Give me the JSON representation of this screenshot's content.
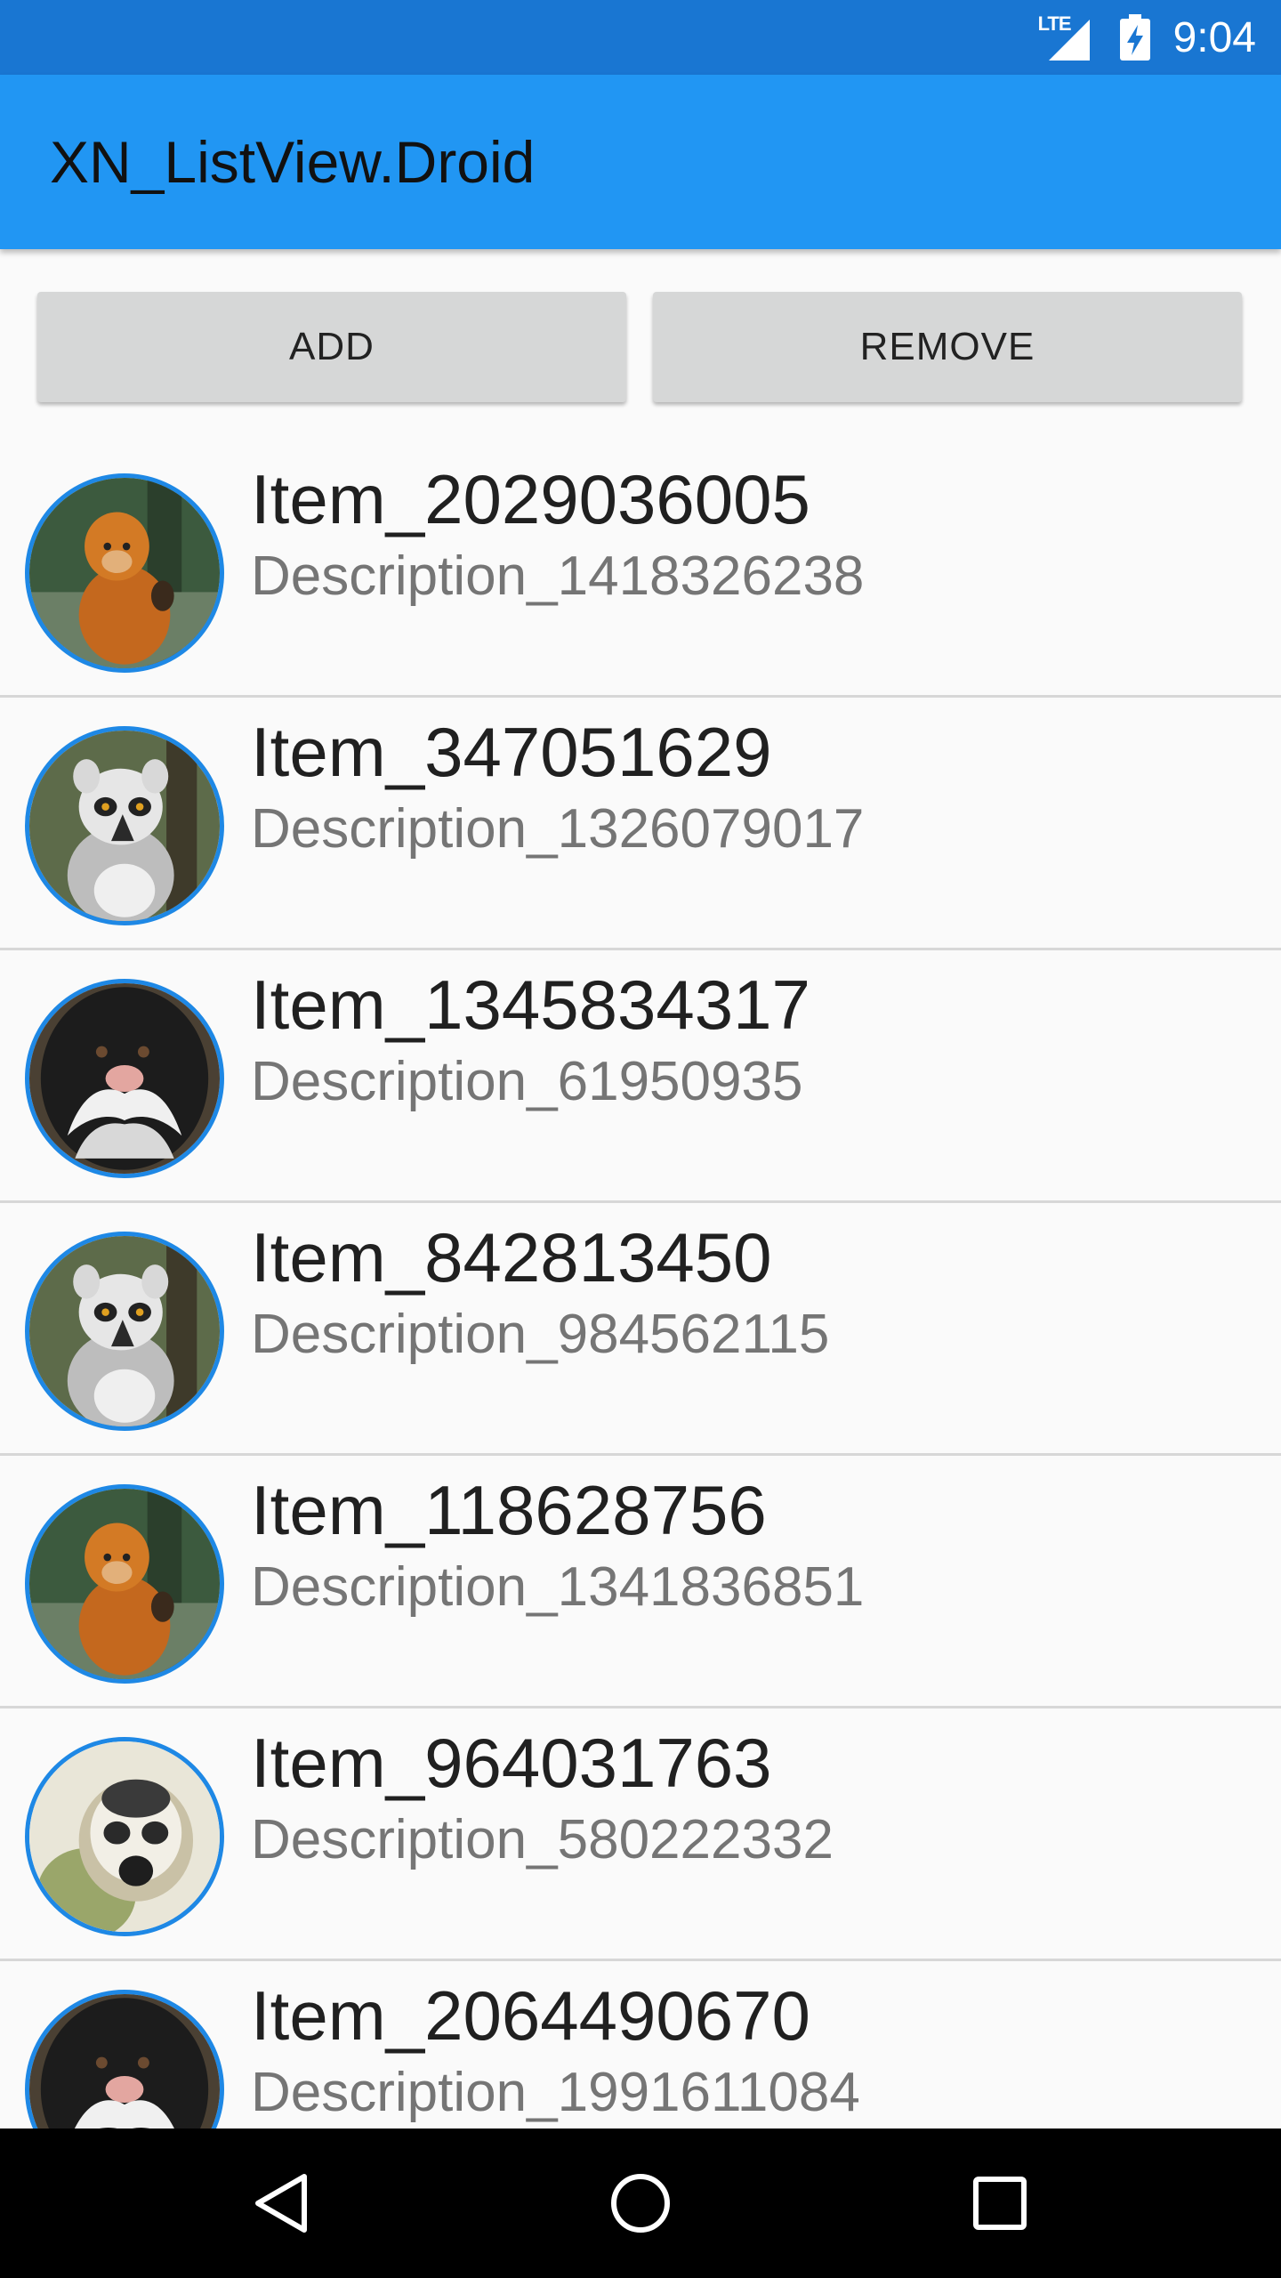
{
  "status_bar": {
    "network_label": "LTE",
    "time": "9:04",
    "background_color": "#1976d2",
    "icons": [
      "lte-signal-icon",
      "battery-charging-icon"
    ]
  },
  "toolbar": {
    "title": "XN_ListView.Droid",
    "background_color": "#2196f3"
  },
  "actions": {
    "add_label": "ADD",
    "remove_label": "REMOVE"
  },
  "list": {
    "items": [
      {
        "title": "Item_2029036005",
        "description": "Description_1418326238",
        "image": "orange-monkey"
      },
      {
        "title": "Item_347051629",
        "description": "Description_1326079017",
        "image": "lemur"
      },
      {
        "title": "Item_1345834317",
        "description": "Description_61950935",
        "image": "emperor-tamarin"
      },
      {
        "title": "Item_842813450",
        "description": "Description_984562115",
        "image": "lemur"
      },
      {
        "title": "Item_118628756",
        "description": "Description_1341836851",
        "image": "orange-monkey"
      },
      {
        "title": "Item_964031763",
        "description": "Description_580222332",
        "image": "squirrel-monkey"
      },
      {
        "title": "Item_2064490670",
        "description": "Description_1991611084",
        "image": "emperor-tamarin"
      }
    ]
  },
  "nav_bar": {
    "icons": [
      "back-triangle-icon",
      "home-circle-icon",
      "recents-square-icon"
    ]
  }
}
